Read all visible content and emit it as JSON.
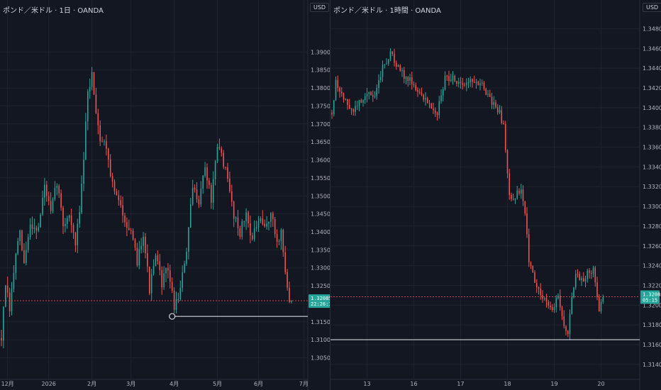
{
  "colors": {
    "up": "#26a69a",
    "down": "#ef5350",
    "bg": "#131722",
    "grid": "#1e222d",
    "text": "#b2b5be"
  },
  "chart_data": [
    {
      "type": "candlestick",
      "title": "ポンド／米ドル · 1日 · OANDA",
      "currency": "USD",
      "ylim": [
        1.3025,
        1.3975
      ],
      "yticks": [
        1.305,
        1.31,
        1.315,
        1.32,
        1.325,
        1.33,
        1.335,
        1.34,
        1.345,
        1.35,
        1.355,
        1.36,
        1.365,
        1.37,
        1.375,
        1.38,
        1.385,
        1.39
      ],
      "ytick_labels": [
        "1.30500",
        "1.31000",
        "1.31500",
        "1.32000",
        "1.32500",
        "1.33000",
        "1.33500",
        "1.34000",
        "1.34500",
        "1.35000",
        "1.35500",
        "1.36000",
        "1.36500",
        "1.37000",
        "1.37500",
        "1.38000",
        "1.38500",
        "1.39000"
      ],
      "xticks": [
        {
          "label": "12月",
          "i": 3
        },
        {
          "label": "2026",
          "i": 23
        },
        {
          "label": "2月",
          "i": 44
        },
        {
          "label": "3月",
          "i": 63
        },
        {
          "label": "4月",
          "i": 84
        },
        {
          "label": "5月",
          "i": 105
        },
        {
          "label": "6月",
          "i": 125
        },
        {
          "label": "7月",
          "i": 147
        }
      ],
      "n_slots": 150,
      "last_price": "1.32085",
      "countdown": "22:26:15",
      "hline": 1.3165,
      "marker_index": 83,
      "anchors": [
        [
          0,
          1.3105
        ],
        [
          2,
          1.3255
        ],
        [
          4,
          1.318
        ],
        [
          7,
          1.334
        ],
        [
          9,
          1.339
        ],
        [
          11,
          1.331
        ],
        [
          14,
          1.342
        ],
        [
          18,
          1.341
        ],
        [
          21,
          1.353
        ],
        [
          24,
          1.345
        ],
        [
          27,
          1.354
        ],
        [
          30,
          1.342
        ],
        [
          33,
          1.345
        ],
        [
          36,
          1.336
        ],
        [
          39,
          1.352
        ],
        [
          42,
          1.378
        ],
        [
          44,
          1.384
        ],
        [
          46,
          1.374
        ],
        [
          48,
          1.366
        ],
        [
          51,
          1.364
        ],
        [
          54,
          1.353
        ],
        [
          57,
          1.348
        ],
        [
          60,
          1.344
        ],
        [
          63,
          1.339
        ],
        [
          66,
          1.332
        ],
        [
          69,
          1.34
        ],
        [
          72,
          1.324
        ],
        [
          75,
          1.333
        ],
        [
          78,
          1.326
        ],
        [
          81,
          1.33
        ],
        [
          84,
          1.319
        ],
        [
          87,
          1.324
        ],
        [
          90,
          1.335
        ],
        [
          93,
          1.352
        ],
        [
          96,
          1.349
        ],
        [
          99,
          1.358
        ],
        [
          102,
          1.349
        ],
        [
          105,
          1.363
        ],
        [
          107,
          1.362
        ],
        [
          110,
          1.354
        ],
        [
          113,
          1.345
        ],
        [
          116,
          1.34
        ],
        [
          119,
          1.345
        ],
        [
          122,
          1.338
        ],
        [
          125,
          1.343
        ],
        [
          128,
          1.341
        ],
        [
          131,
          1.345
        ],
        [
          134,
          1.337
        ],
        [
          136,
          1.34
        ],
        [
          138,
          1.329
        ],
        [
          140,
          1.32
        ],
        [
          141,
          1.3208
        ]
      ]
    },
    {
      "type": "candlestick",
      "title": "ポンド／米ドル · 1時間 · OANDA",
      "currency": "USD",
      "ylim": [
        1.3132,
        1.349
      ],
      "yticks": [
        1.314,
        1.316,
        1.318,
        1.32,
        1.322,
        1.324,
        1.326,
        1.328,
        1.33,
        1.332,
        1.334,
        1.336,
        1.338,
        1.34,
        1.342,
        1.344,
        1.346,
        1.348
      ],
      "ytick_labels": [
        "1.31400",
        "1.31600",
        "1.31800",
        "1.32000",
        "1.32200",
        "1.32400",
        "1.32600",
        "1.32800",
        "1.33000",
        "1.33200",
        "1.33400",
        "1.33600",
        "1.33800",
        "1.34000",
        "1.34200",
        "1.34400",
        "1.34600",
        "1.34800"
      ],
      "xticks": [
        {
          "label": "13",
          "i": 18
        },
        {
          "label": "16",
          "i": 42
        },
        {
          "label": "17",
          "i": 66
        },
        {
          "label": "18",
          "i": 90
        },
        {
          "label": "19",
          "i": 114
        },
        {
          "label": "20",
          "i": 138
        }
      ],
      "n_slots": 155,
      "last_price": "1.32085",
      "countdown": "05:15",
      "hline": 1.3165,
      "anchors": [
        [
          0,
          1.3395
        ],
        [
          2,
          1.3425
        ],
        [
          6,
          1.341
        ],
        [
          10,
          1.3395
        ],
        [
          14,
          1.3405
        ],
        [
          18,
          1.3415
        ],
        [
          22,
          1.341
        ],
        [
          26,
          1.344
        ],
        [
          30,
          1.3455
        ],
        [
          34,
          1.344
        ],
        [
          38,
          1.343
        ],
        [
          42,
          1.3425
        ],
        [
          46,
          1.341
        ],
        [
          50,
          1.3405
        ],
        [
          54,
          1.3395
        ],
        [
          58,
          1.343
        ],
        [
          62,
          1.343
        ],
        [
          66,
          1.3425
        ],
        [
          70,
          1.3425
        ],
        [
          74,
          1.3428
        ],
        [
          78,
          1.342
        ],
        [
          82,
          1.3405
        ],
        [
          86,
          1.3395
        ],
        [
          88,
          1.338
        ],
        [
          90,
          1.3335
        ],
        [
          91,
          1.3315
        ],
        [
          93,
          1.3305
        ],
        [
          95,
          1.3315
        ],
        [
          97,
          1.3315
        ],
        [
          99,
          1.3295
        ],
        [
          101,
          1.3245
        ],
        [
          104,
          1.3225
        ],
        [
          107,
          1.321
        ],
        [
          110,
          1.3205
        ],
        [
          113,
          1.3195
        ],
        [
          116,
          1.321
        ],
        [
          119,
          1.318
        ],
        [
          121,
          1.3172
        ],
        [
          123,
          1.3205
        ],
        [
          125,
          1.323
        ],
        [
          128,
          1.3225
        ],
        [
          131,
          1.3232
        ],
        [
          134,
          1.3235
        ],
        [
          135,
          1.3225
        ],
        [
          137,
          1.3195
        ],
        [
          139,
          1.3208
        ]
      ]
    }
  ]
}
